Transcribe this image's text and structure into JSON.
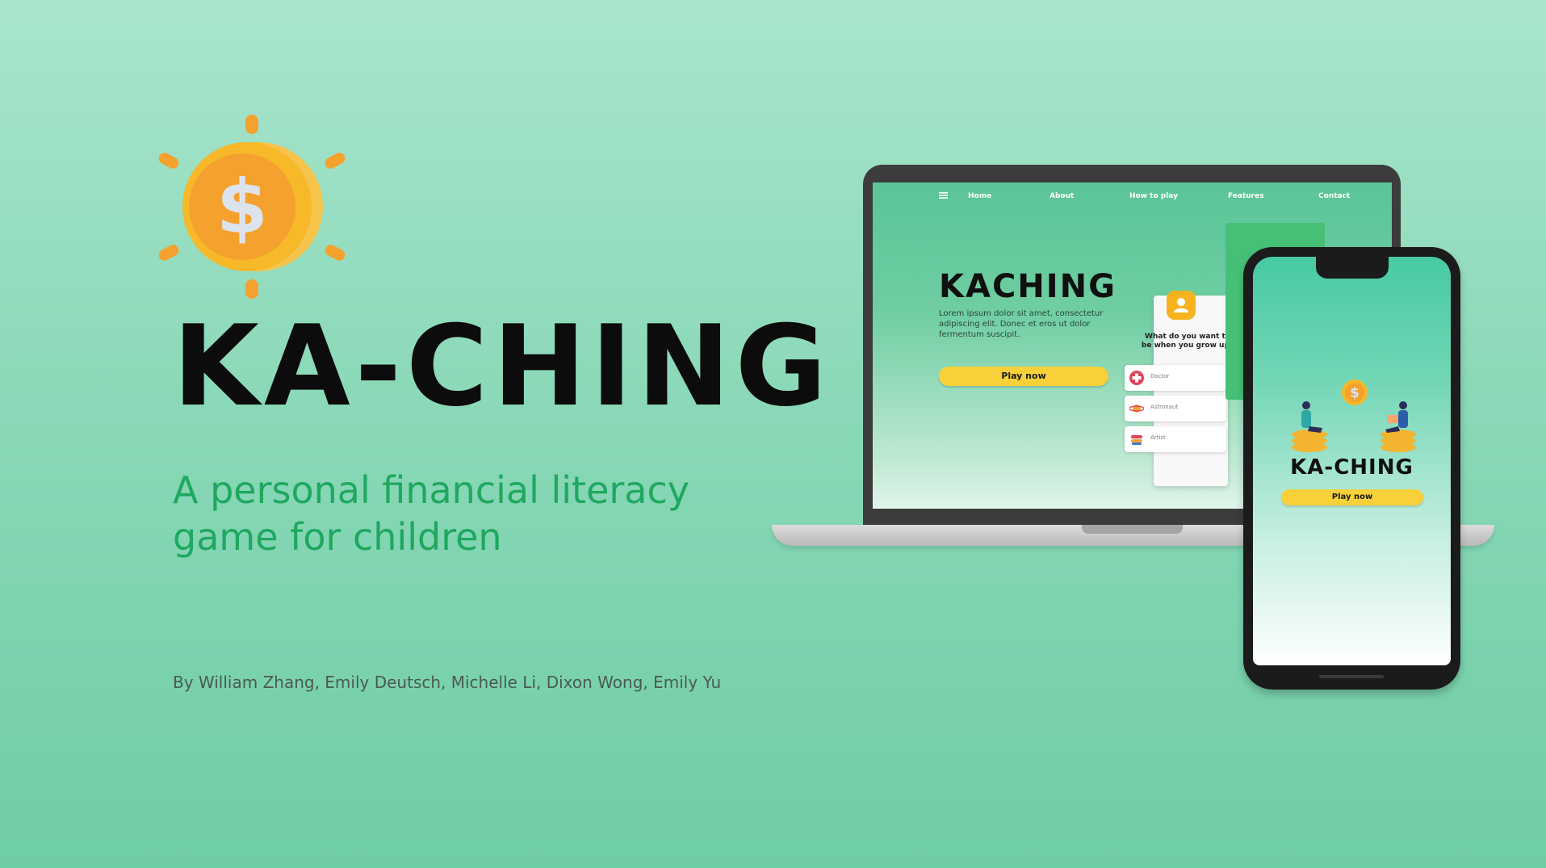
{
  "title": "KA-CHING",
  "subtitle": "A personal financial literacy game for children",
  "credits": "By William Zhang, Emily Deutsch, Michelle Li, Dixon Wong, Emily Yu",
  "logo": {
    "icon": "dollar-coin-icon",
    "symbol": "$",
    "colors": {
      "coin": "#f4a12e",
      "rim": "#f6c44a",
      "rays": "#f4a12e",
      "symbol": "#dde3ec"
    }
  },
  "laptop": {
    "nav": [
      "Home",
      "About",
      "How to play",
      "Features",
      "Contact"
    ],
    "headline": "KACHING",
    "lorem": "Lorem ipsum dolor sit amet, consectetur adipiscing elit. Donec et eros ut dolor fermentum suscipit.",
    "play_label": "Play now",
    "question": "What do you want to be when you grow up?",
    "options": [
      {
        "label": "Doctor",
        "icon": "medical-cross-icon"
      },
      {
        "label": "Astronaut",
        "icon": "planet-icon"
      },
      {
        "label": "Artist",
        "icon": "paint-icon"
      }
    ]
  },
  "phone": {
    "title": "KA-CHING",
    "play_label": "Play now"
  },
  "colors": {
    "accent_green": "#1fa85f",
    "button_yellow": "#f8d13a",
    "title_black": "#0c0c0c"
  }
}
